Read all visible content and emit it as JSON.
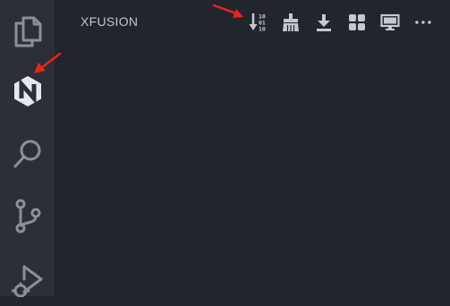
{
  "activity_bar": {
    "items": [
      {
        "icon": "files-icon"
      },
      {
        "icon": "hexagon-logo-icon"
      },
      {
        "icon": "search-icon"
      },
      {
        "icon": "source-control-icon"
      },
      {
        "icon": "run-debug-icon"
      }
    ]
  },
  "panel": {
    "title": "XFUSION",
    "toolbar": [
      {
        "icon": "binary-sort-icon"
      },
      {
        "icon": "broom-icon"
      },
      {
        "icon": "download-icon"
      },
      {
        "icon": "grid-icon"
      },
      {
        "icon": "monitor-icon"
      },
      {
        "icon": "more-icon"
      }
    ]
  },
  "colors": {
    "editor_bg": "#22252c",
    "activity_bg": "#2c2f37",
    "icon": "#c5c8ce",
    "icon_muted": "#8b8f98",
    "annotation": "#e8251d"
  }
}
